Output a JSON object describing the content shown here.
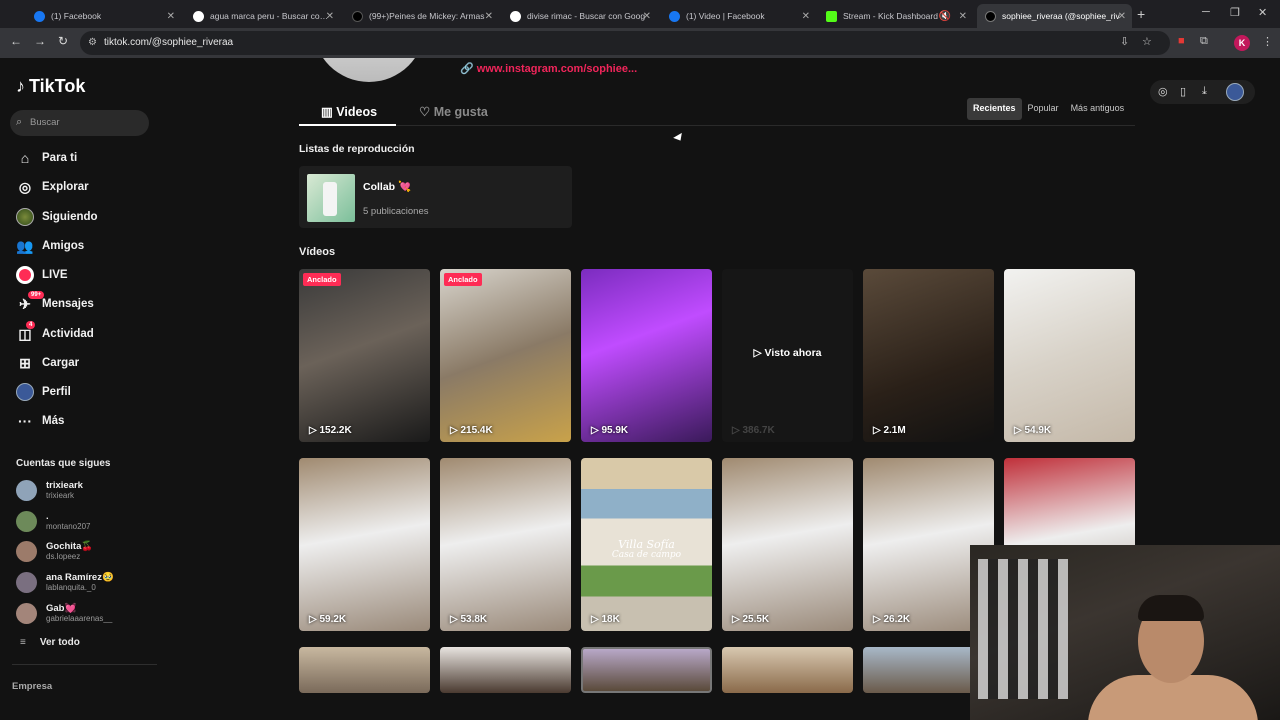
{
  "browser": {
    "tabs": [
      {
        "label": "(1) Facebook",
        "icon": "facebook-icon",
        "color": "#1877f2"
      },
      {
        "label": "agua marca peru - Buscar con G",
        "icon": "google-icon",
        "color": "#ffffff"
      },
      {
        "label": "(99+)Peines de Mickey: Armas",
        "icon": "tiktok-icon",
        "color": "#000000"
      },
      {
        "label": "divise rimac - Buscar con Goog",
        "icon": "google-icon",
        "color": "#ffffff"
      },
      {
        "label": "(1) Video | Facebook",
        "icon": "facebook-icon",
        "color": "#1877f2"
      },
      {
        "label": "Stream - Kick Dashboard",
        "icon": "kick-icon",
        "color": "#53fc18"
      },
      {
        "label": "sophiee_riveraa (@sophiee_riv",
        "icon": "tiktok-icon",
        "color": "#000000"
      }
    ],
    "url": "tiktok.com/@sophiee_riveraa",
    "profile_initial": "K"
  },
  "sidebar": {
    "logo": "TikTok",
    "search_placeholder": "Buscar",
    "nav": [
      {
        "label": "Para ti",
        "icon": "home-icon"
      },
      {
        "label": "Explorar",
        "icon": "compass-icon"
      },
      {
        "label": "Siguiendo",
        "icon": "following-avatar-icon"
      },
      {
        "label": "Amigos",
        "icon": "friends-icon"
      },
      {
        "label": "LIVE",
        "icon": "live-icon"
      },
      {
        "label": "Mensajes",
        "icon": "messages-icon",
        "badge": "99+"
      },
      {
        "label": "Actividad",
        "icon": "activity-icon",
        "badge": "4"
      },
      {
        "label": "Cargar",
        "icon": "upload-icon"
      },
      {
        "label": "Perfil",
        "icon": "profile-icon"
      },
      {
        "label": "Más",
        "icon": "more-icon"
      }
    ],
    "following_title": "Cuentas que sigues",
    "following": [
      {
        "name": "trixieark",
        "handle": "trixieark"
      },
      {
        "name": ".",
        "handle": "montano207"
      },
      {
        "name": "Gochita🍒",
        "handle": "ds.lopeez"
      },
      {
        "name": "ana Ramírez🥹",
        "handle": "lablanquita._0"
      },
      {
        "name": "Gab💓",
        "handle": "gabrielaaarenas__"
      }
    ],
    "see_all": "Ver todo",
    "footer": "Empresa"
  },
  "profile": {
    "instagram_link": "www.instagram.com/sophiee...",
    "tabs": [
      "Videos",
      "Me gusta"
    ],
    "sort_options": [
      "Recientes",
      "Popular",
      "Más antiguos"
    ],
    "sort_selected": "Recientes",
    "playlists_title": "Listas de reproducción",
    "playlist": {
      "name": "Collab",
      "emoji": "💘",
      "count": "5 publicaciones"
    },
    "videos_title": "Vídeos",
    "videos": [
      {
        "views": "152.2K",
        "pinned": "Anclado"
      },
      {
        "views": "215.4K",
        "pinned": "Anclado"
      },
      {
        "views": "95.9K"
      },
      {
        "views": "386.7K",
        "watched": "Visto ahora"
      },
      {
        "views": "2.1M"
      },
      {
        "views": "54.9K"
      },
      {
        "views": "59.2K"
      },
      {
        "views": "53.8K"
      },
      {
        "views": "18K",
        "caption_1": "Villa Sofía",
        "caption_2": "Casa de campo"
      },
      {
        "views": "25.5K"
      },
      {
        "views": "26.2K"
      },
      {
        "views": ""
      }
    ]
  },
  "colors": {
    "accent": "#fe2c55",
    "background": "#121212",
    "link": "#f0255a"
  }
}
